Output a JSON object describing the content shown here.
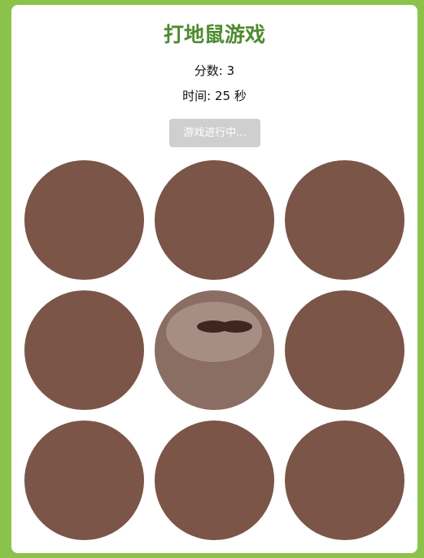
{
  "game": {
    "title": "打地鼠游戏",
    "score_label": "分数:",
    "score_value": "3",
    "time_label": "时间:",
    "time_value": "25",
    "time_unit": "秒",
    "status_button": "游戏进行中..."
  },
  "board": {
    "rows": 3,
    "cols": 3,
    "active_hole": 5,
    "colors": {
      "hole": "#7a5548",
      "active_hole": "#8a6d63",
      "mole_face": "#b8a39a",
      "mole_eyes": "#3f2620",
      "background": "#8bc34a",
      "title": "#4e8b2f",
      "button": "#cfcfcf"
    }
  }
}
